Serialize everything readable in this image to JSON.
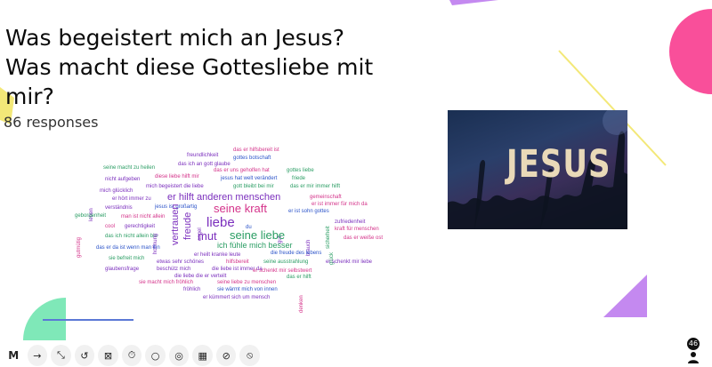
{
  "title": "Was begeistert mich an Jesus? Was macht diese Gottesliebe mit mir?",
  "responses": "86 responses",
  "participant_count": "46",
  "photo_text": "JESUS",
  "colors": {
    "pink": "#f94f9a",
    "purple": "#c489f0",
    "yellow": "#f3e878",
    "mint": "#7fe8b8",
    "bluegreen": "#5b78d6"
  },
  "toolbar": [
    "logo-icon",
    "arrow-right-icon",
    "collapse-icon",
    "reset-icon",
    "close-box-icon",
    "timer-icon",
    "comment-icon",
    "reactions-icon",
    "qr-code-icon",
    "hide-icon",
    "block-icon"
  ],
  "word_cloud": [
    {
      "text": "das er hilfsbereit ist",
      "color": "#d4338a",
      "size": 6
    },
    {
      "text": "freundlichkeit",
      "color": "#7b2fbd",
      "size": 6
    },
    {
      "text": "gottes botschaft",
      "color": "#2c54c9",
      "size": 6
    },
    {
      "text": "das ich an gott glaube",
      "color": "#7b2fbd",
      "size": 6
    },
    {
      "text": "seine macht zu heilen",
      "color": "#2a9d63",
      "size": 6
    },
    {
      "text": "das er uns geholfen hat",
      "color": "#d4338a",
      "size": 6
    },
    {
      "text": "gottes liebe",
      "color": "#2a9d63",
      "size": 6
    },
    {
      "text": "diese liebe hilft mir",
      "color": "#d4338a",
      "size": 6
    },
    {
      "text": "jesus hat welt verändert",
      "color": "#2c54c9",
      "size": 6
    },
    {
      "text": "friede",
      "color": "#2a9d63",
      "size": 6
    },
    {
      "text": "nicht aufgeben",
      "color": "#7b2fbd",
      "size": 6
    },
    {
      "text": "mich begeistert die liebe",
      "color": "#7b2fbd",
      "size": 6
    },
    {
      "text": "gott bleibt bei mir",
      "color": "#2a9d63",
      "size": 6
    },
    {
      "text": "das er mir immer hilft",
      "color": "#2a9d63",
      "size": 6
    },
    {
      "text": "mich glücklich",
      "color": "#7b2fbd",
      "size": 6
    },
    {
      "text": "er hilft anderen menschen",
      "color": "#7b2fbd",
      "size": 11
    },
    {
      "text": "gemeinschaft",
      "color": "#d4338a",
      "size": 6
    },
    {
      "text": "er hört immer zu",
      "color": "#7b2fbd",
      "size": 6
    },
    {
      "text": "er ist immer für mich da",
      "color": "#d4338a",
      "size": 6
    },
    {
      "text": "verständnis",
      "color": "#7b2fbd",
      "size": 6
    },
    {
      "text": "jesus ist großartig",
      "color": "#2c54c9",
      "size": 6
    },
    {
      "text": "seine kraft",
      "color": "#d4338a",
      "size": 13
    },
    {
      "text": "er ist sohn gottes",
      "color": "#2c54c9",
      "size": 6
    },
    {
      "text": "leben",
      "color": "#7b2fbd",
      "size": 6
    },
    {
      "text": "geborgenheit",
      "color": "#2a9d63",
      "size": 6
    },
    {
      "text": "man ist nicht allein",
      "color": "#d4338a",
      "size": 6
    },
    {
      "text": "engel",
      "color": "#7b2fbd",
      "size": 6
    },
    {
      "text": "gut",
      "color": "#7b2fbd",
      "size": 6
    },
    {
      "text": "zufriedenheit",
      "color": "#7b2fbd",
      "size": 6
    },
    {
      "text": "liebe",
      "color": "#7b2fbd",
      "size": 15
    },
    {
      "text": "cool",
      "color": "#d4338a",
      "size": 6
    },
    {
      "text": "gerechtigkeit",
      "color": "#7b2fbd",
      "size": 6
    },
    {
      "text": "du",
      "color": "#2c54c9",
      "size": 6
    },
    {
      "text": "kraft für menschen",
      "color": "#d4338a",
      "size": 6
    },
    {
      "text": "freude",
      "color": "#7b2fbd",
      "size": 11
    },
    {
      "text": "mut",
      "color": "#7b2fbd",
      "size": 13
    },
    {
      "text": "seine liebe",
      "color": "#2a9d63",
      "size": 13
    },
    {
      "text": "sicherheit",
      "color": "#2a9d63",
      "size": 6
    },
    {
      "text": "das ich nicht allein bin",
      "color": "#2a9d63",
      "size": 6
    },
    {
      "text": "das er weiße ost",
      "color": "#d4338a",
      "size": 6
    },
    {
      "text": "gutmütig",
      "color": "#d4338a",
      "size": 6
    },
    {
      "text": "vertrauen",
      "color": "#7b2fbd",
      "size": 11
    },
    {
      "text": "hoffnung",
      "color": "#7b2fbd",
      "size": 6
    },
    {
      "text": "ich fühle mich besser",
      "color": "#2a9d63",
      "size": 9
    },
    {
      "text": "glück",
      "color": "#2a9d63",
      "size": 6
    },
    {
      "text": "das er da ist wenn man ihn",
      "color": "#2c54c9",
      "size": 6
    },
    {
      "text": "brauch",
      "color": "#7b2fbd",
      "size": 6
    },
    {
      "text": "er heilt kranke leute",
      "color": "#7b2fbd",
      "size": 6
    },
    {
      "text": "die freude des lebens",
      "color": "#2c54c9",
      "size": 6
    },
    {
      "text": "sie befreit mich",
      "color": "#2a9d63",
      "size": 6
    },
    {
      "text": "etwas sehr schönes",
      "color": "#7b2fbd",
      "size": 6
    },
    {
      "text": "hilfsbereit",
      "color": "#d4338a",
      "size": 6
    },
    {
      "text": "seine ausstrahlung",
      "color": "#2a9d63",
      "size": 6
    },
    {
      "text": "er schenkt mir liebe",
      "color": "#7b2fbd",
      "size": 6
    },
    {
      "text": "glaubensfrage",
      "color": "#7b2fbd",
      "size": 6
    },
    {
      "text": "beschütz mich",
      "color": "#7b2fbd",
      "size": 6
    },
    {
      "text": "die liebe ist immer da",
      "color": "#7b2fbd",
      "size": 6
    },
    {
      "text": "er schenkt mir selbstwert",
      "color": "#d4338a",
      "size": 6
    },
    {
      "text": "die liebe die er verteilt",
      "color": "#7b2fbd",
      "size": 6
    },
    {
      "text": "das er hilft",
      "color": "#2a9d63",
      "size": 6
    },
    {
      "text": "sie macht mich fröhlich",
      "color": "#d4338a",
      "size": 6
    },
    {
      "text": "seine liebe zu menschen",
      "color": "#d4338a",
      "size": 6
    },
    {
      "text": "fröhlich",
      "color": "#7b2fbd",
      "size": 6
    },
    {
      "text": "sie wärmt mich von innen",
      "color": "#2c54c9",
      "size": 6
    },
    {
      "text": "denken",
      "color": "#d4338a",
      "size": 6
    },
    {
      "text": "er kümmert sich um mensch",
      "color": "#7b2fbd",
      "size": 6
    }
  ]
}
